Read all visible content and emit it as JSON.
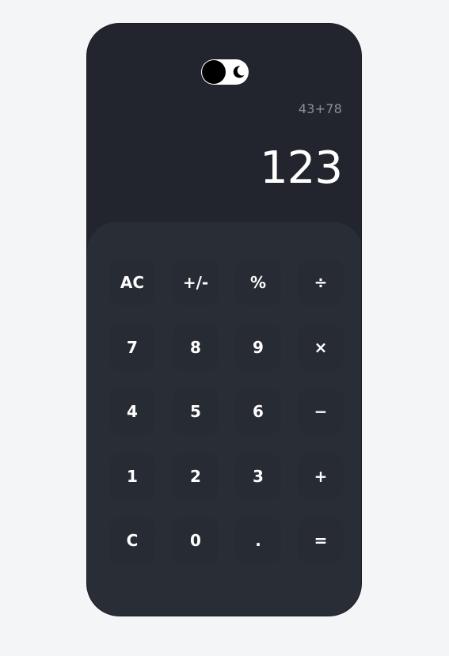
{
  "theme_toggle": {
    "icon": "moon-icon"
  },
  "display": {
    "expression": "43+78",
    "result": "123"
  },
  "keys": [
    {
      "label": "AC",
      "name": "key-ac"
    },
    {
      "label": "+/-",
      "name": "key-plus-minus"
    },
    {
      "label": "%",
      "name": "key-percent"
    },
    {
      "label": "÷",
      "name": "key-divide"
    },
    {
      "label": "7",
      "name": "key-7"
    },
    {
      "label": "8",
      "name": "key-8"
    },
    {
      "label": "9",
      "name": "key-9"
    },
    {
      "label": "×",
      "name": "key-multiply"
    },
    {
      "label": "4",
      "name": "key-4"
    },
    {
      "label": "5",
      "name": "key-5"
    },
    {
      "label": "6",
      "name": "key-6"
    },
    {
      "label": "−",
      "name": "key-minus"
    },
    {
      "label": "1",
      "name": "key-1"
    },
    {
      "label": "2",
      "name": "key-2"
    },
    {
      "label": "3",
      "name": "key-3"
    },
    {
      "label": "+",
      "name": "key-plus"
    },
    {
      "label": "C",
      "name": "key-c"
    },
    {
      "label": "0",
      "name": "key-0"
    },
    {
      "label": ".",
      "name": "key-decimal"
    },
    {
      "label": "=",
      "name": "key-equals"
    }
  ]
}
